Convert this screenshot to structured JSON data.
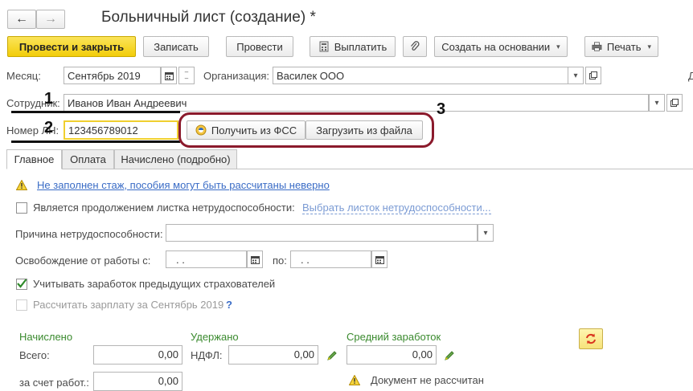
{
  "window": {
    "title": "Больничный лист (создание) *",
    "back_icon": "←",
    "forward_icon": "→"
  },
  "toolbar": {
    "post_close": "Провести и закрыть",
    "save": "Записать",
    "post": "Провести",
    "pay": "Выплатить",
    "create_based": "Создать на основании",
    "print": "Печать"
  },
  "form": {
    "month_label": "Месяц:",
    "month_value": "Сентябрь 2019",
    "org_label": "Организация:",
    "org_value": "Василек ООО",
    "employee_label": "Сотрудник:",
    "employee_value": "Иванов Иван Андреевич",
    "ln_label": "Номер ЛН:",
    "ln_value": "123456789012",
    "get_fss": "Получить из ФСС",
    "load_file": "Загрузить из файла",
    "cut_letter": "Д"
  },
  "annotations": {
    "n1": "1",
    "n2": "2",
    "n3": "3"
  },
  "tabs": [
    "Главное",
    "Оплата",
    "Начислено (подробно)"
  ],
  "main": {
    "warning_link": "Не заполнен стаж, пособия могут быть рассчитаны неверно",
    "continuation_label": "Является продолжением листка нетрудоспособности:",
    "continuation_link": "Выбрать листок нетрудоспособности...",
    "reason_label": "Причина нетрудоспособности:",
    "release_label": "Освобождение от работы с:",
    "release_from": " .  .",
    "release_to_label": "по:",
    "release_to": " .  .",
    "prev_insurers": "Учитывать заработок предыдущих страхователей",
    "calc_salary": "Рассчитать зарплату за Сентябрь 2019",
    "help": "?"
  },
  "totals": {
    "accrued_header": "Начислено",
    "total_label": "Всего:",
    "total_value": "0,00",
    "employer_label": "за счет работ.:",
    "employer_value": "0,00",
    "withheld_header": "Удержано",
    "ndfl_label": "НДФЛ:",
    "ndfl_value": "0,00",
    "avg_header": "Средний заработок",
    "avg_value": "0,00",
    "not_calculated": "Документ не рассчитан"
  },
  "colors": {
    "primary_button": "#f2cd09",
    "annotation_ring": "#8b1a2c",
    "green_header": "#3a8a2e",
    "link": "#3a6cc6"
  }
}
